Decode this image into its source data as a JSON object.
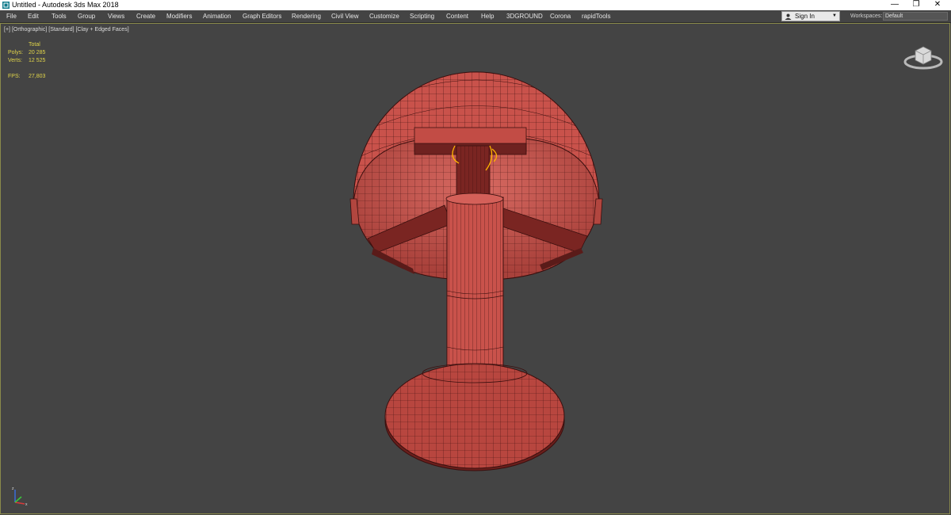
{
  "window": {
    "title": "Untitled - Autodesk 3ds Max 2018",
    "minimize_glyph": "—",
    "maximize_glyph": "❐",
    "close_glyph": "✕",
    "app_icon": "3dsmax-app-icon"
  },
  "menubar": {
    "items": [
      "File",
      "Edit",
      "Tools",
      "Group",
      "Views",
      "Create",
      "Modifiers",
      "Animation",
      "Graph Editors",
      "Rendering",
      "Civil View",
      "Customize",
      "Scripting",
      "Content",
      "Help",
      "3DGROUND",
      "Corona",
      "rapidTools"
    ],
    "sign_in": "Sign In",
    "workspaces_label": "Workspaces:",
    "workspace_value": "Default"
  },
  "viewport": {
    "label_plus": "[+]",
    "label_view": "[Orthographic]",
    "label_shading_style": "[Standard]",
    "label_shading": "[Clay + Edged Faces]",
    "stats": {
      "total_label": "Total",
      "polys_label": "Polys:",
      "polys_value": "20 285",
      "verts_label": "Verts:",
      "verts_value": "12 525",
      "fps_label": "FPS:",
      "fps_value": "27,803"
    }
  },
  "colors": {
    "viewport_bg": "#444444",
    "stats_text": "#e0d44a",
    "mesh_fill": "#c0504a",
    "mesh_dark": "#7a2522",
    "wire": "#3a0f0e",
    "selection": "#ffb400"
  }
}
